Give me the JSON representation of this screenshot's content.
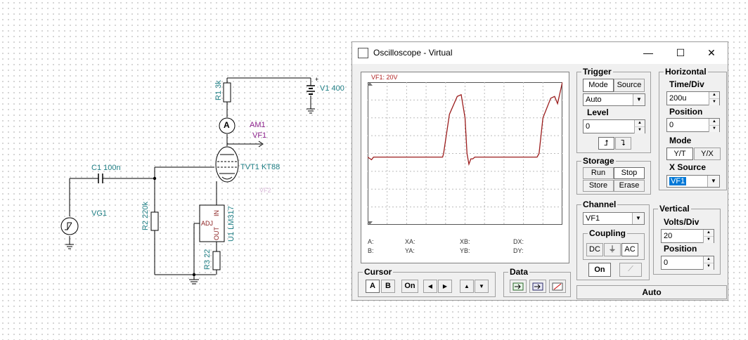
{
  "schematic": {
    "r1": "R1 3k",
    "v1": "V1 400",
    "v1_plus": "+",
    "am1": "AM1",
    "ammeter_symbol": "A",
    "vf1": "VF1",
    "c1": "C1 100n",
    "tube": "TVT1 KT88",
    "vf_ghost": "VF2",
    "vg1": "VG1",
    "r2": "R2 220k",
    "adj": "ADJ",
    "in_pin": "IN",
    "out_pin": "OUT",
    "u1": "U1 LM317",
    "r3": "R3 22",
    "plus": "+"
  },
  "window": {
    "title": "Oscilloscope - Virtual",
    "minimize": "—",
    "maximize": "☐",
    "close": "✕"
  },
  "screen": {
    "channel_label": "VF1: 20V",
    "readouts": {
      "a": "A:",
      "b": "B:",
      "xa": "XA:",
      "ya": "YA:",
      "xb": "XB:",
      "yb": "YB:",
      "dx": "DX:",
      "dy": "DY:"
    },
    "trace_color": "#9b1c1c"
  },
  "chart_data": {
    "type": "line",
    "title": "VF1: 20V",
    "series": [
      {
        "name": "VF1",
        "x": [
          0,
          0.02,
          0.03,
          0.08,
          0.2,
          0.3,
          0.385,
          0.39,
          0.42,
          0.46,
          0.48,
          0.5,
          0.51,
          0.52,
          0.53,
          0.54,
          0.55,
          0.6,
          0.7,
          0.8,
          0.87,
          0.88,
          0.9,
          0.94,
          0.96,
          0.975,
          1.0
        ],
        "y": [
          -0.2,
          -0.35,
          -0.2,
          -0.2,
          -0.2,
          -0.2,
          -0.2,
          0.0,
          2.2,
          3.2,
          3.3,
          2.0,
          0.0,
          -0.6,
          -0.3,
          -0.3,
          -0.2,
          -0.2,
          -0.2,
          -0.2,
          -0.2,
          0.0,
          2.0,
          3.1,
          3.2,
          2.8,
          4.0
        ]
      }
    ],
    "ylim": [
      -4,
      4
    ],
    "xlim": [
      0,
      1
    ],
    "grid": true
  },
  "trigger": {
    "title": "Trigger",
    "mode_btn": "Mode",
    "source_btn": "Source",
    "mode_value": "Auto",
    "level_label": "Level",
    "level_value": "0",
    "rise_icon": "⮥",
    "fall_icon": "⮧"
  },
  "horizontal": {
    "title": "Horizontal",
    "timediv_label": "Time/Div",
    "timediv_value": "200u",
    "position_label": "Position",
    "position_value": "0",
    "mode_label": "Mode",
    "yt": "Y/T",
    "yx": "Y/X",
    "xsource_label": "X Source",
    "xsource_value": "VF1"
  },
  "storage": {
    "title": "Storage",
    "run": "Run",
    "stop": "Stop",
    "store": "Store",
    "erase": "Erase"
  },
  "channel": {
    "title": "Channel",
    "value": "VF1",
    "coupling_label": "Coupling",
    "dc": "DC",
    "gnd": "⏚",
    "ac": "AC",
    "on": "On"
  },
  "vertical": {
    "title": "Vertical",
    "voltsdiv_label": "Volts/Div",
    "voltsdiv_value": "20",
    "position_label": "Position",
    "position_value": "0"
  },
  "cursor": {
    "title": "Cursor",
    "a": "A",
    "b": "B",
    "on": "On",
    "left": "◀",
    "right": "▶",
    "up": "▲",
    "down": "▼"
  },
  "data_group": {
    "title": "Data"
  },
  "auto_label": "Auto"
}
